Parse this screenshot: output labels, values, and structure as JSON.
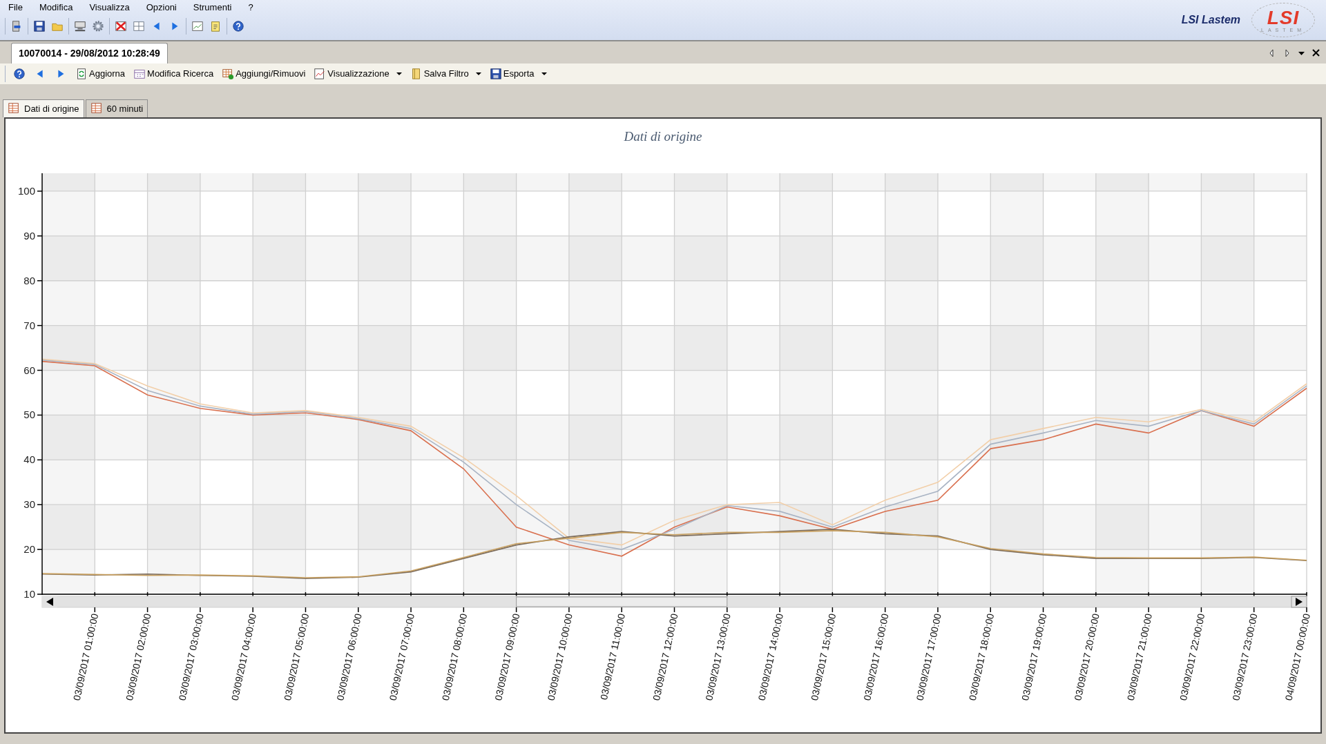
{
  "menu": [
    {
      "label": "File"
    },
    {
      "label": "Modifica"
    },
    {
      "label": "Visualizza"
    },
    {
      "label": "Opzioni"
    },
    {
      "label": "Strumenti"
    },
    {
      "label": "?"
    }
  ],
  "brand": {
    "name": "LSI Lastem",
    "logo_mark": "LSI",
    "logo_subtitle": "LASTEM"
  },
  "document_tabs": [
    {
      "label": "10070014 - 29/08/2012 10:28:49",
      "selected": true
    }
  ],
  "view_toolbar": [
    {
      "label": "Aggiorna",
      "dropdown": false
    },
    {
      "label": "Modifica Ricerca",
      "dropdown": false
    },
    {
      "label": "Aggiungi/Rimuovi",
      "dropdown": false
    },
    {
      "label": "Visualizzazione",
      "dropdown": true
    },
    {
      "label": "Salva Filtro",
      "dropdown": true
    },
    {
      "label": "Esporta",
      "dropdown": true
    }
  ],
  "view_tabs": [
    {
      "label": "Dati di origine",
      "selected": true
    },
    {
      "label": "60 minuti",
      "selected": false
    }
  ],
  "chart": {
    "chart_data": {
      "type": "line",
      "title": "Dati di origine",
      "categories": [
        null,
        "03/09/2017 01:00:00",
        "03/09/2017 02:00:00",
        "03/09/2017 03:00:00",
        "03/09/2017 04:00:00",
        "03/09/2017 05:00:00",
        "03/09/2017 06:00:00",
        "03/09/2017 07:00:00",
        "03/09/2017 08:00:00",
        "03/09/2017 09:00:00",
        "03/09/2017 10:00:00",
        "03/09/2017 11:00:00",
        "03/09/2017 12:00:00",
        "03/09/2017 13:00:00",
        "03/09/2017 14:00:00",
        "03/09/2017 15:00:00",
        "03/09/2017 16:00:00",
        "03/09/2017 17:00:00",
        "03/09/2017 18:00:00",
        "03/09/2017 19:00:00",
        "03/09/2017 20:00:00",
        "03/09/2017 21:00:00",
        "03/09/2017 22:00:00",
        "03/09/2017 23:00:00",
        "04/09/2017 00:00:00"
      ],
      "series": [
        {
          "color": "#d9704f",
          "values": [
            62,
            61,
            54.5,
            51.5,
            50,
            50.5,
            49,
            46.5,
            38,
            25,
            21,
            18.5,
            25,
            29.5,
            27.5,
            24.5,
            28.5,
            31,
            42.5,
            44.5,
            48,
            46,
            51,
            47.5,
            56
          ]
        },
        {
          "color": "#a9b4c4",
          "values": [
            62.3,
            61.3,
            55.5,
            52,
            50.2,
            50.8,
            49.2,
            47,
            39.5,
            30,
            22,
            20,
            24.5,
            29.8,
            28.5,
            25,
            29.5,
            33,
            43.5,
            46,
            48.8,
            47.5,
            51,
            48,
            56.5
          ]
        },
        {
          "color": "#f2cfa9",
          "values": [
            62.5,
            61.5,
            56.5,
            52.5,
            50.5,
            51,
            49.5,
            47.5,
            40.5,
            32,
            22.5,
            21,
            26.5,
            30,
            30.5,
            25.5,
            31,
            35,
            44.5,
            47,
            49.5,
            48.5,
            51.3,
            48.5,
            57
          ]
        },
        {
          "color": "#7a6a5a",
          "values": [
            14.5,
            14.3,
            14.5,
            14.2,
            14,
            13.5,
            13.8,
            15,
            18,
            21,
            22.8,
            24,
            23,
            23.5,
            24,
            24.5,
            23.5,
            23,
            20,
            18.8,
            18,
            18,
            18,
            18.2,
            17.5
          ]
        },
        {
          "color": "#c8a060",
          "values": [
            14.6,
            14.4,
            14.2,
            14.3,
            14.1,
            13.7,
            13.9,
            15.2,
            18.2,
            21.3,
            22.5,
            23.8,
            23.3,
            23.8,
            23.8,
            24.2,
            23.8,
            22.8,
            20.2,
            19,
            18.2,
            18.1,
            18.1,
            18.3,
            17.6
          ]
        }
      ],
      "ylim": [
        10,
        104
      ],
      "grid": true,
      "bands": [
        {
          "axis": "y",
          "from": 20,
          "to": 30
        },
        {
          "axis": "y",
          "from": 40,
          "to": 50
        },
        {
          "axis": "y",
          "from": 60,
          "to": 70
        },
        {
          "axis": "y",
          "from": 80,
          "to": 90
        },
        {
          "axis": "y",
          "from": 100,
          "to": 104
        }
      ],
      "yticks": [
        10,
        20,
        30,
        40,
        50,
        60,
        70,
        80,
        90,
        100
      ]
    }
  }
}
